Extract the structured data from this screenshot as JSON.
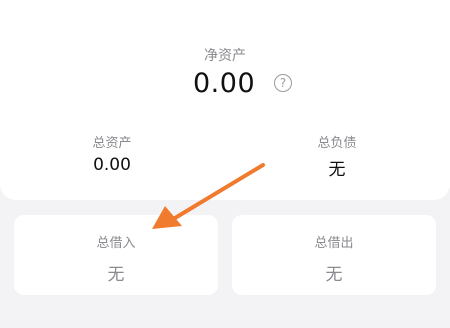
{
  "summary": {
    "net_assets_label": "净资产",
    "net_assets_value": "0.00",
    "help_icon": "question-circle-icon",
    "total_assets_label": "总资产",
    "total_assets_value": "0.00",
    "total_liabilities_label": "总负债",
    "total_liabilities_value": "无"
  },
  "tiles": {
    "borrowed_in_label": "总借入",
    "borrowed_in_value": "无",
    "lent_out_label": "总借出",
    "lent_out_value": "无"
  },
  "annotation": {
    "arrow_color": "#f07a2e",
    "icon": "arrow-pointer-icon"
  },
  "colors": {
    "background": "#f3f3f5",
    "card": "#ffffff",
    "primary_text": "#111111",
    "secondary_text": "#8a8a8f"
  }
}
